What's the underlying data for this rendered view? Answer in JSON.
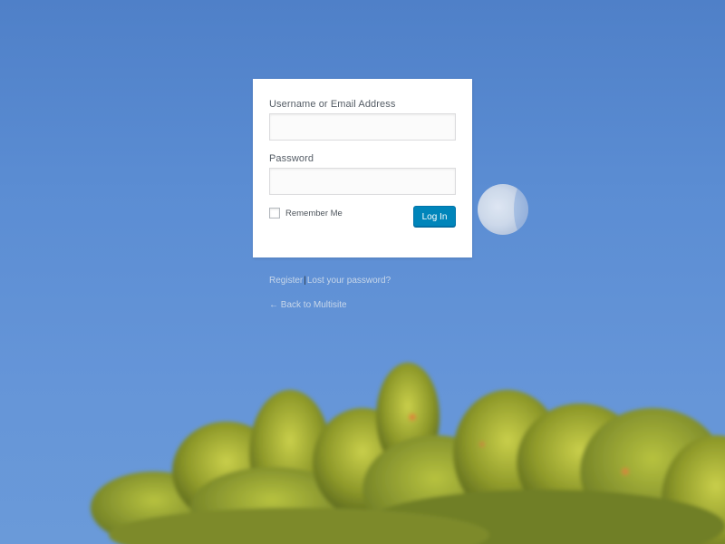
{
  "login_form": {
    "username_label": "Username or Email Address",
    "username_value": "",
    "password_label": "Password",
    "password_value": "",
    "remember_label": "Remember Me",
    "remember_checked": false,
    "submit_label": "Log In"
  },
  "links": {
    "register": "Register",
    "separator": "|",
    "lost_password": "Lost your password?",
    "back": "← Back to Multisite"
  },
  "colors": {
    "sky": "#5b8dd3",
    "button": "#0085ba",
    "card": "#ffffff"
  },
  "background": {
    "foreground_image": "tree-canopy",
    "sky_object": "moon"
  }
}
